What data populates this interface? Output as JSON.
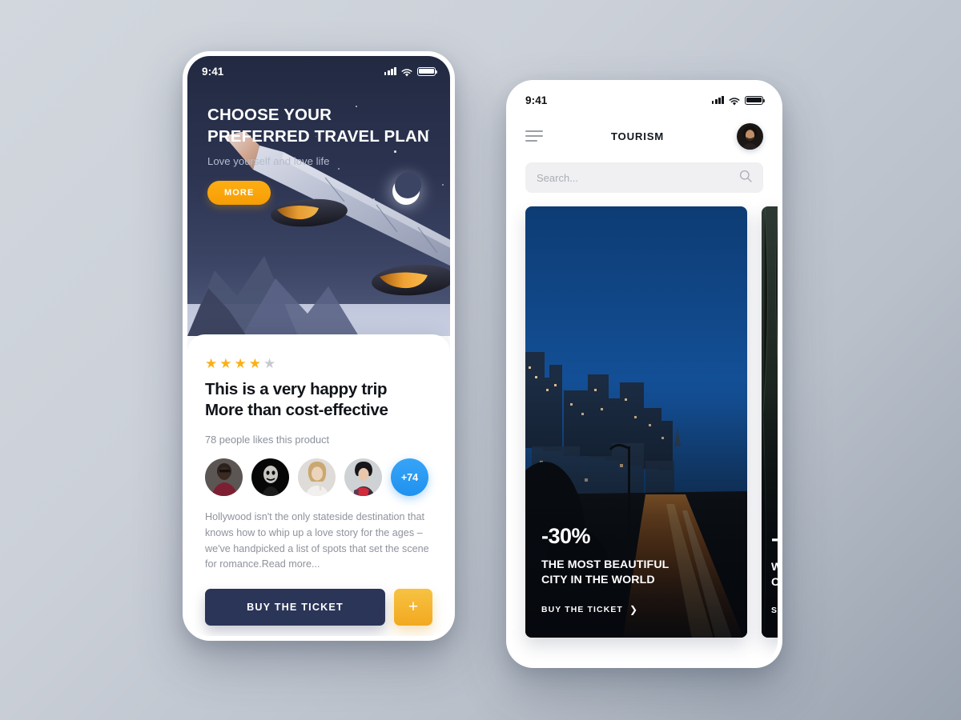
{
  "scene": {
    "background_top": "#d2d7de",
    "background_bottom": "#99a2af"
  },
  "phone_left": {
    "status_bar": {
      "time": "9:41",
      "signal_icon": "signal-bars-icon",
      "wifi_icon": "wifi-icon",
      "battery_icon": "battery-icon"
    },
    "hero": {
      "title": "CHOOSE YOUR PREFERRED TRAVEL PLAN",
      "subtitle": "Love yourself and love life",
      "more_button": "MORE",
      "illustration": "airplane-wing-night-sky",
      "accent_color": "#f79d04"
    },
    "card": {
      "rating": {
        "value": 4,
        "max": 5,
        "filled_color": "#fbb016",
        "empty_color": "#c6cad0"
      },
      "title_line1": "This is a very happy trip",
      "title_line2": "More than cost-effective",
      "likes_text": "78 people likes this product",
      "avatars": [
        {
          "name": "avatar-person-1"
        },
        {
          "name": "avatar-person-2"
        },
        {
          "name": "avatar-person-3"
        },
        {
          "name": "avatar-person-4"
        }
      ],
      "avatar_more_label": "+74",
      "avatar_more_color": "#2091ef",
      "description": "Hollywood isn't the only stateside destination that knows how to whip up a love story for the ages – we've handpicked a list of spots that set the scene for romance.Read more...",
      "buy_button": "BUY THE TICKET",
      "buy_button_color": "#2b3558",
      "plus_button": "+",
      "plus_button_color": "#f2a91f"
    }
  },
  "phone_right": {
    "status_bar": {
      "time": "9:41",
      "signal_icon": "signal-bars-icon",
      "wifi_icon": "wifi-icon",
      "battery_icon": "battery-icon"
    },
    "nav": {
      "menu_icon": "hamburger-menu-icon",
      "title": "TOURISM",
      "avatar": "user-avatar"
    },
    "search": {
      "placeholder": "Search...",
      "value": "",
      "icon": "search-icon"
    },
    "cards": [
      {
        "image": "city-skyline-twilight",
        "discount": "-30%",
        "headline_line1": "THE MOST BEAUTIFUL",
        "headline_line2": "CITY IN THE WORLD",
        "cta": "BUY THE TICKET",
        "cta_icon": "chevron-right-icon"
      },
      {
        "image": "forest-lake-dark",
        "discount": "-",
        "headline_line1": "W",
        "headline_line2": "C",
        "cta": "S"
      }
    ]
  }
}
